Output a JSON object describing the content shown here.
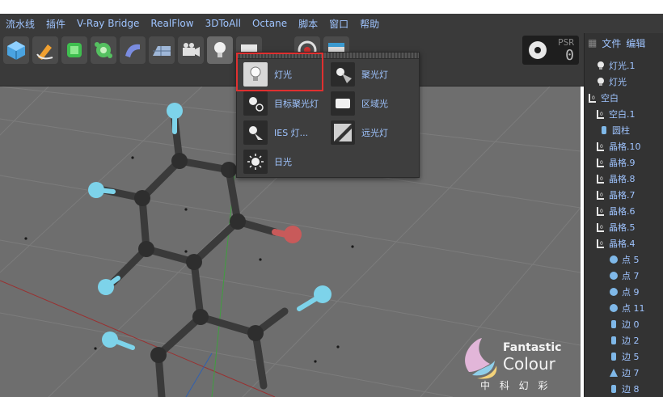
{
  "menu": [
    "流水线",
    "插件",
    "V-Ray Bridge",
    "RealFlow",
    "3DToAll",
    "Octane",
    "脚本",
    "窗口",
    "帮助"
  ],
  "psr": {
    "label": "PSR",
    "value": "0"
  },
  "right_panel": {
    "tabs": [
      "文件",
      "编辑"
    ],
    "tree": [
      {
        "label": "灯光.1",
        "icon": "light-bulb"
      },
      {
        "label": "灯光",
        "icon": "light-bulb"
      },
      {
        "label": "空白",
        "icon": "null-object"
      },
      {
        "label": "空白.1",
        "icon": "null-object"
      },
      {
        "label": "圆柱",
        "icon": "cylinder"
      },
      {
        "label": "晶格.10",
        "icon": "null-object"
      },
      {
        "label": "晶格.9",
        "icon": "null-object"
      },
      {
        "label": "晶格.8",
        "icon": "null-object"
      },
      {
        "label": "晶格.7",
        "icon": "null-object"
      },
      {
        "label": "晶格.6",
        "icon": "null-object"
      },
      {
        "label": "晶格.5",
        "icon": "null-object"
      },
      {
        "label": "晶格.4",
        "icon": "null-object"
      },
      {
        "label": "点 5",
        "icon": "sphere"
      },
      {
        "label": "点 7",
        "icon": "sphere"
      },
      {
        "label": "点 9",
        "icon": "sphere"
      },
      {
        "label": "点 11",
        "icon": "sphere"
      },
      {
        "label": "边 0",
        "icon": "cylinder"
      },
      {
        "label": "边 2",
        "icon": "cylinder"
      },
      {
        "label": "边 5",
        "icon": "cylinder"
      },
      {
        "label": "边 7",
        "icon": "polygon"
      },
      {
        "label": "边 8",
        "icon": "cylinder"
      }
    ]
  },
  "light_popup": {
    "items": [
      {
        "label": "灯光",
        "icon": "light-bulb"
      },
      {
        "label": "聚光灯",
        "icon": "spot-light"
      },
      {
        "label": "目标聚光灯",
        "icon": "target-spot-light"
      },
      {
        "label": "区域光",
        "icon": "area-light"
      },
      {
        "label": "IES 灯...",
        "icon": "ies-light"
      },
      {
        "label": "远光灯",
        "icon": "infinite-light"
      },
      {
        "label": "日光",
        "icon": "sun-light"
      }
    ]
  },
  "watermark": {
    "line1": "Fantastic",
    "line2": "Colour",
    "line3": "中 科 幻 彩"
  },
  "colors": {
    "menu_text": "#9fc4ff",
    "highlight": "#e03030",
    "atom_blue": "#7dd3ea",
    "atom_red": "#c85a5a"
  }
}
